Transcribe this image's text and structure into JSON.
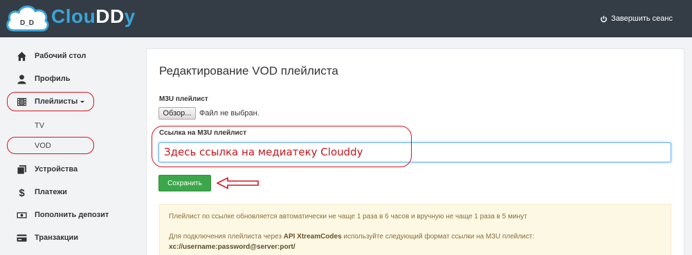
{
  "header": {
    "brand_part1": "Clou",
    "brand_part2": "DD",
    "brand_part3": "y",
    "logo_text": "D_D",
    "logout_label": "Завершить сеанс",
    "logout_icon": "power-icon",
    "bg_color": "#343d46",
    "accent_color": "#3aa4d8"
  },
  "sidebar": {
    "items": [
      {
        "label": "Рабочий стол",
        "icon": "home-icon"
      },
      {
        "label": "Профиль",
        "icon": "user-icon"
      },
      {
        "label": "Плейлисты",
        "icon": "film-icon"
      },
      {
        "label": "Устройства",
        "icon": "devices-icon"
      },
      {
        "label": "Платежи",
        "icon": "dollar-icon"
      },
      {
        "label": "Пополнить депозит",
        "icon": "cash-icon"
      },
      {
        "label": "Транзакции",
        "icon": "card-icon"
      }
    ],
    "subitems": [
      "TV",
      "VOD"
    ]
  },
  "main": {
    "title": "Редактирование VOD плейлиста",
    "m3u_label": "M3U плейлист",
    "file_button": "Обзор...",
    "file_status": "Файл не выбран.",
    "url_label": "Ссылка на M3U плейлист",
    "url_value": "Здесь ссылка на медиатеку Clouddy",
    "save_button": "Сохранить",
    "save_color": "#3ba74a"
  },
  "alert": {
    "line1": "Плейлист по ссылке обновляется автоматически не чаще 1 раза в 6 часов и вручную не чаще 1 раза в 5 минут",
    "line2_prefix": "Для подключения плейлиста через ",
    "line2_bold": "API XtreamCodes",
    "line2_suffix": " используйте следующий формат ссылки на M3U плейлист:",
    "code": "xc://username:password@server:port/"
  },
  "annotations": {
    "highlight_color": "#d4141c"
  }
}
